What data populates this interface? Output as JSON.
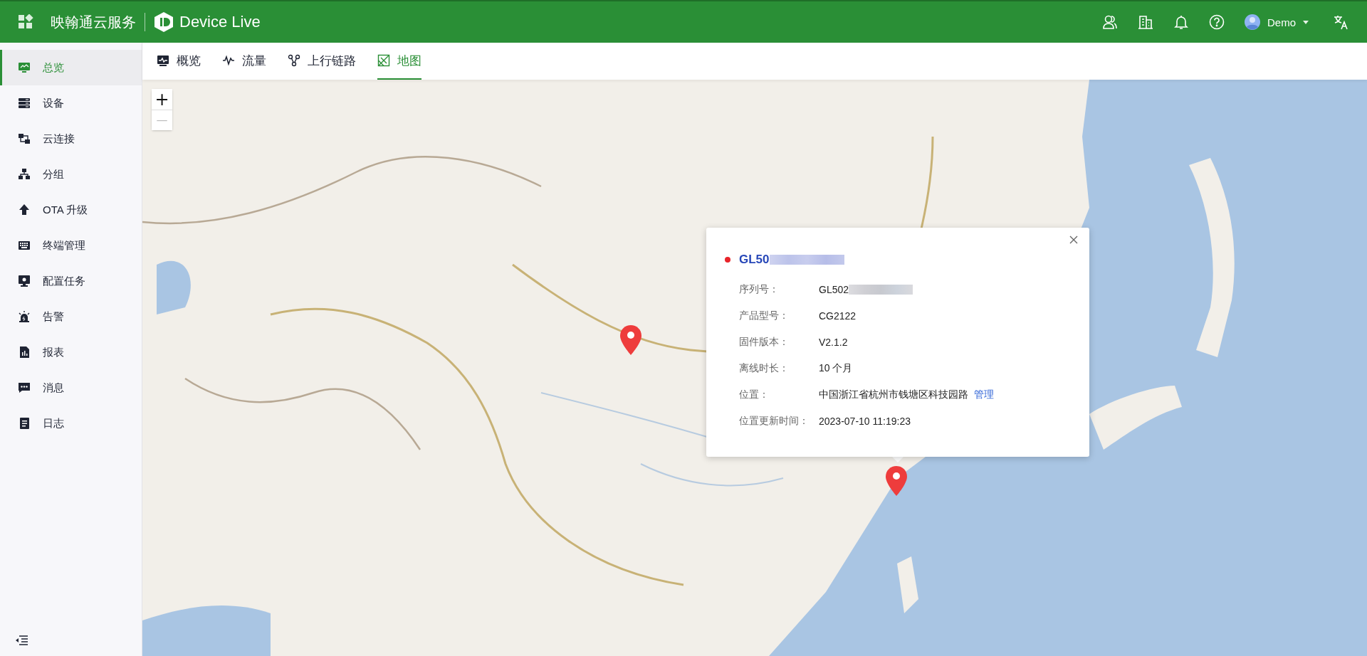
{
  "header": {
    "brand": "映翰通云服务",
    "product": "Device Live",
    "user": "Demo"
  },
  "sidebar": {
    "items": [
      {
        "label": "总览",
        "selected": true
      },
      {
        "label": "设备",
        "selected": false
      },
      {
        "label": "云连接",
        "selected": false
      },
      {
        "label": "分组",
        "selected": false
      },
      {
        "label": "OTA 升级",
        "selected": false
      },
      {
        "label": "终端管理",
        "selected": false
      },
      {
        "label": "配置任务",
        "selected": false
      },
      {
        "label": "告警",
        "selected": false
      },
      {
        "label": "报表",
        "selected": false
      },
      {
        "label": "消息",
        "selected": false
      },
      {
        "label": "日志",
        "selected": false
      }
    ]
  },
  "tabs": [
    {
      "label": "概览",
      "selected": false
    },
    {
      "label": "流量",
      "selected": false
    },
    {
      "label": "上行链路",
      "selected": false
    },
    {
      "label": "地图",
      "selected": true
    }
  ],
  "map": {
    "kind": "picture",
    "zoom_in": "+",
    "zoom_out": "—",
    "popup": {
      "title": "GL50",
      "online": false,
      "rows": [
        {
          "label": "序列号：",
          "value": "GL502",
          "redacted": true
        },
        {
          "label": "产品型号：",
          "value": "CG2122"
        },
        {
          "label": "固件版本：",
          "value": "V2.1.2"
        },
        {
          "label": "离线时长：",
          "value": "10 个月"
        },
        {
          "label": "位置：",
          "value": "中国浙江省杭州市钱塘区科技园路",
          "link": "管理"
        },
        {
          "label": "位置更新时间：",
          "value": "2023-07-10 11:19:23"
        }
      ]
    }
  }
}
